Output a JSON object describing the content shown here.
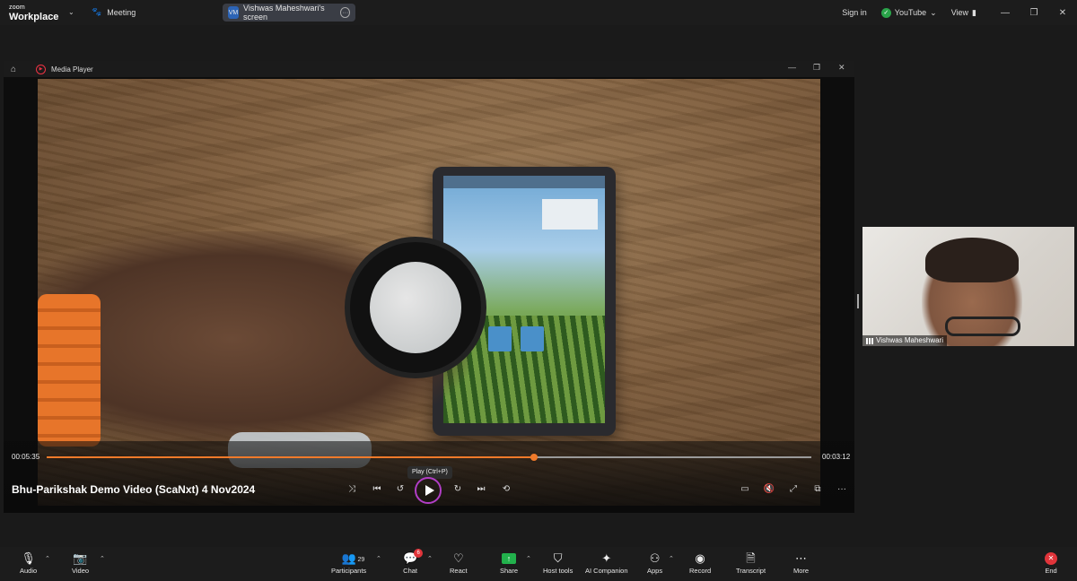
{
  "topbar": {
    "logo_line1": "zoom",
    "logo_line2": "Workplace",
    "meeting_label": "Meeting",
    "share_initials": "VM",
    "share_label": "Vishwas Maheshwari's screen",
    "signin": "Sign in",
    "youtube": "YouTube",
    "view": "View"
  },
  "media_player": {
    "title": "Media Player",
    "video_title": "Bhu-Parikshak Demo Video (ScaNxt) 4 Nov2024",
    "elapsed": "00:05:35",
    "remaining": "00:03:12",
    "progress_fraction": 0.637,
    "tooltip": "Play (Ctrl+P)"
  },
  "participant": {
    "name": "Vishwas Maheshwari"
  },
  "toolbar": {
    "audio": "Audio",
    "video": "Video",
    "participants": "Participants",
    "participants_count": "29",
    "chat": "Chat",
    "chat_badge": "6",
    "react": "React",
    "share": "Share",
    "host_tools": "Host tools",
    "ai_companion": "AI Companion",
    "apps": "Apps",
    "record": "Record",
    "transcript": "Transcript",
    "more": "More",
    "end": "End"
  },
  "colors": {
    "accent_orange": "#f07a2a",
    "share_green": "#22b14c",
    "end_red": "#e0343a",
    "play_ring": "#b13ec6"
  }
}
